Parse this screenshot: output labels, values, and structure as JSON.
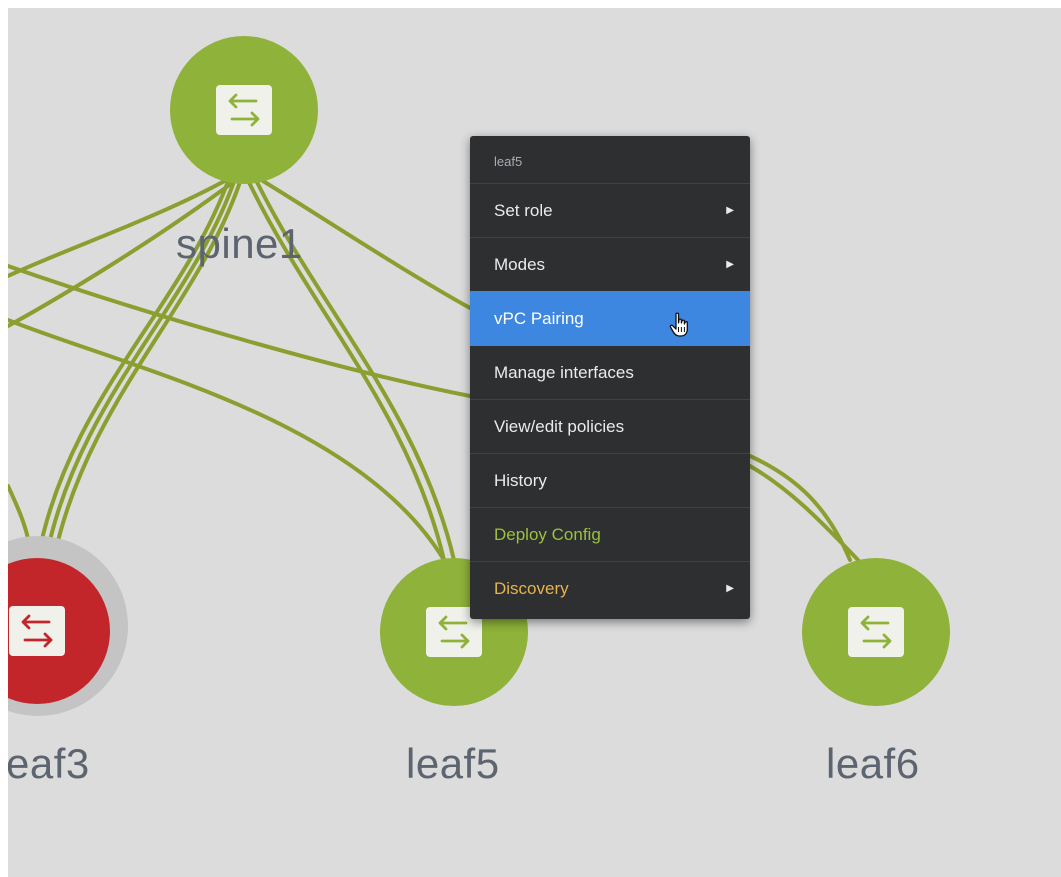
{
  "colors": {
    "canvas_bg": "#dcdcdc",
    "node_green": "#8fb23a",
    "node_red": "#c3262a",
    "link_green": "#8a9f2f",
    "menu_bg": "#2d2f31",
    "menu_active": "#3d87e0",
    "deploy_text": "#9cc23c",
    "discovery_text": "#e5b54a",
    "label_text": "#5c6470"
  },
  "nodes": [
    {
      "id": "spine1",
      "label": "spine1",
      "status": "ok",
      "icon": "switch-arrows-icon"
    },
    {
      "id": "leaf3",
      "label": "eaf3",
      "status": "error",
      "icon": "switch-arrows-icon"
    },
    {
      "id": "leaf5",
      "label": "leaf5",
      "status": "ok",
      "icon": "switch-arrows-icon"
    },
    {
      "id": "leaf6",
      "label": "leaf6",
      "status": "ok",
      "icon": "switch-arrows-icon"
    }
  ],
  "context_menu": {
    "title": "leaf5",
    "items": [
      {
        "label": "Set role",
        "has_submenu": true
      },
      {
        "label": "Modes",
        "has_submenu": true
      },
      {
        "label": "vPC Pairing",
        "has_submenu": false,
        "active": true
      },
      {
        "label": "Manage interfaces",
        "has_submenu": false
      },
      {
        "label": "View/edit policies",
        "has_submenu": false
      },
      {
        "label": "History",
        "has_submenu": false
      },
      {
        "label": "Deploy Config",
        "has_submenu": false,
        "text_color": "#9cc23c"
      },
      {
        "label": "Discovery",
        "has_submenu": true,
        "text_color": "#e5b54a"
      }
    ],
    "submenu_arrow": "▶"
  }
}
